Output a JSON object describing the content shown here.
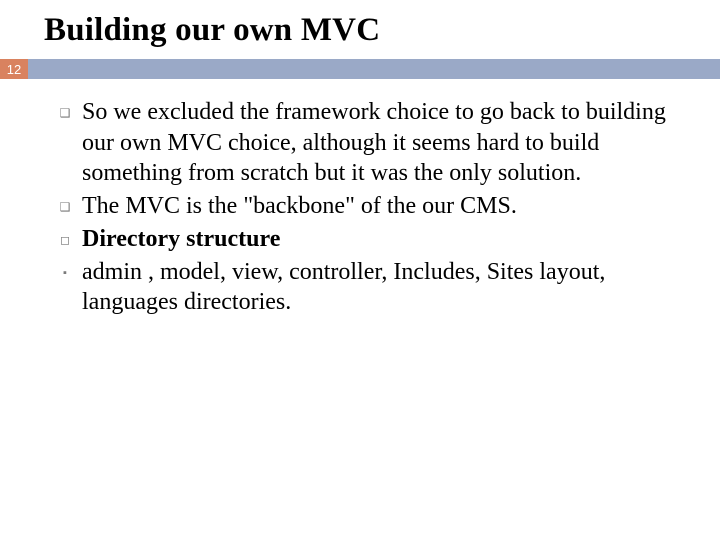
{
  "slide": {
    "title": "Building our own MVC",
    "page_number": "12"
  },
  "items": [
    {
      "bullet": "hollow-square",
      "bold": false,
      "text": "So we excluded the framework choice to go back to building our own MVC choice, although it seems hard to build something from scratch but it was the only solution."
    },
    {
      "bullet": "hollow-square",
      "bold": false,
      "text": "The MVC is the \"backbone\" of the our CMS."
    },
    {
      "bullet": "hollow-box",
      "bold": true,
      "text": "Directory structure"
    },
    {
      "bullet": "solid-square",
      "bold": false,
      "text": "admin , model, view, controller, Includes, Sites layout, languages directories."
    }
  ],
  "bullets": {
    "hollow-square": "❑",
    "hollow-box": "◻",
    "solid-square": "▪"
  }
}
